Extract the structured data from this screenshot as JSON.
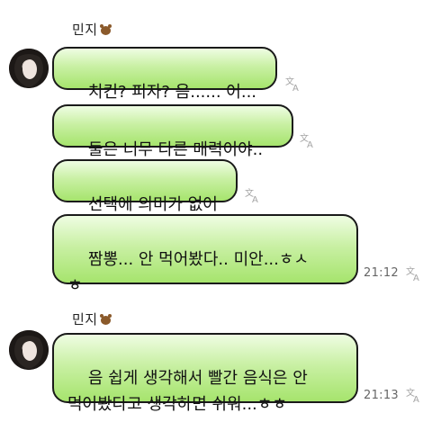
{
  "sender1": {
    "name": "민지",
    "name_icon": "bear-emoji-icon"
  },
  "sender2": {
    "name": "민지",
    "name_icon": "bear-emoji-icon"
  },
  "messages": [
    {
      "text": "치킨? 피자? 음...... 어..."
    },
    {
      "text": "둘은 너무 다른 매력이야.."
    },
    {
      "text": "선택에 의미가 없어"
    },
    {
      "text": "짬뽕... 안 먹어봤다.. 미안...ㅎㅅ\nㅎ",
      "time": "21:12"
    },
    {
      "text": "음 쉽게 생각해서 빨간 음식은 안\n먹어봤다고 생각하면 쉬워...ㅎㅎ",
      "time": "21:13"
    }
  ],
  "icons": {
    "translate": "translate-icon",
    "avatar": "profile-avatar"
  }
}
